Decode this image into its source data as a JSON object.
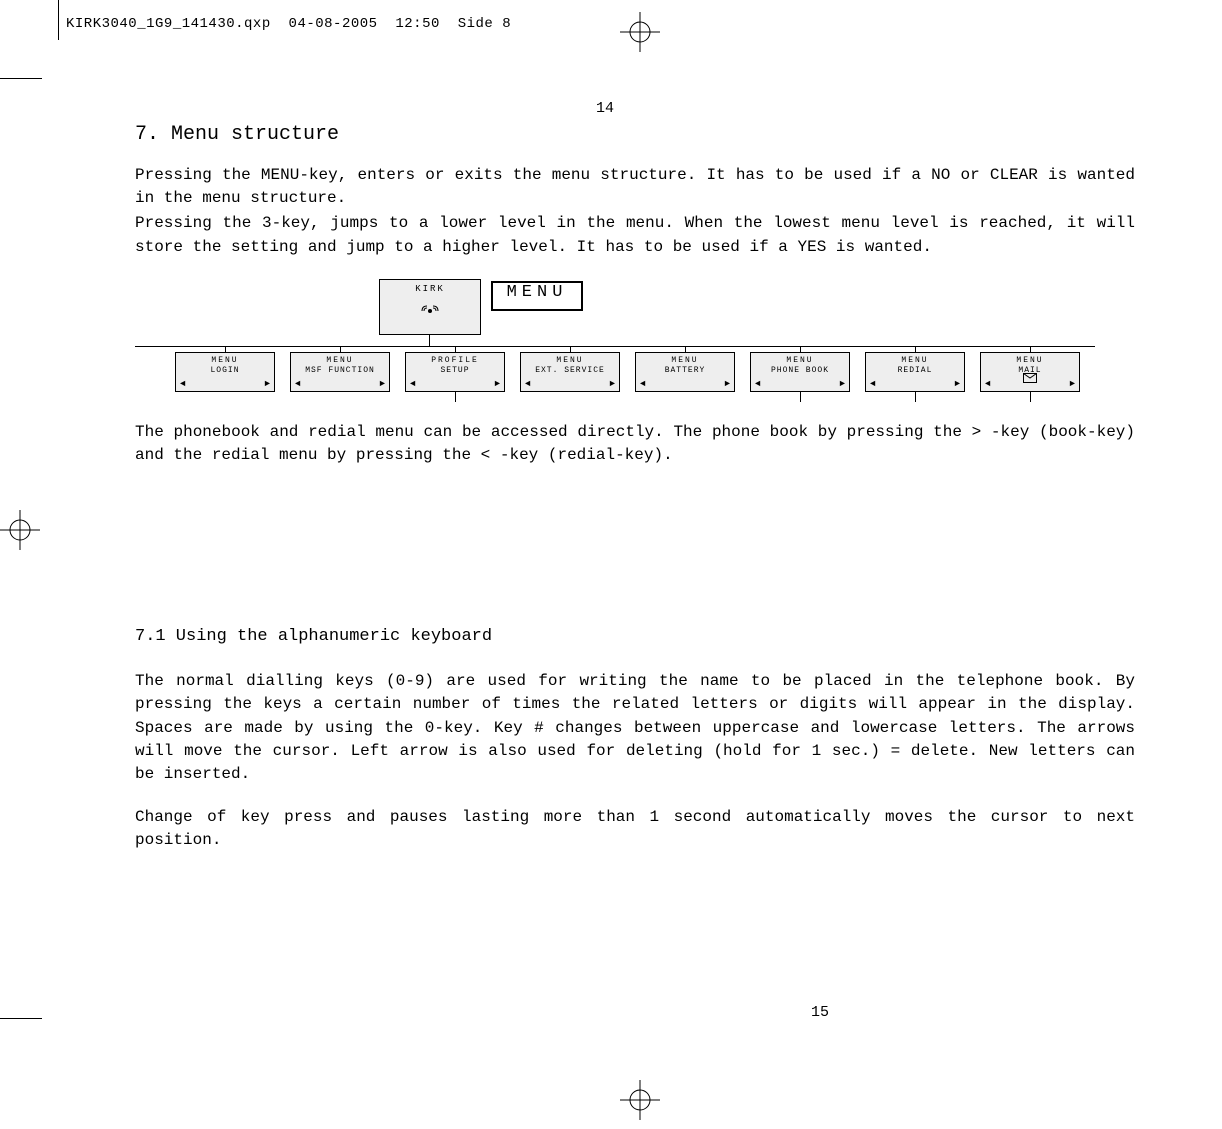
{
  "header": {
    "filename": "KIRK3040_1G9_141430.qxp",
    "date": "04-08-2005",
    "time": "12:50",
    "side": "Side 8"
  },
  "page": {
    "top_number": "14",
    "bottom_number": "15"
  },
  "section7": {
    "title": "7. Menu structure",
    "para1": "Pressing the MENU-key, enters or exits the menu structure. It has to be used if a  NO  or  CLEAR  is wanted in the menu structure.",
    "para2": "Pressing the  3-key, jumps to a lower level in the menu. When the lowest menu level is reached, it will store the setting and jump to a higher level. It has to be used if a  YES  is wanted.",
    "after_diagram": "The phonebook and redial menu can be accessed directly. The phone book by pressing the > -key (book-key) and the redial menu by pressing the < -key (redial-key)."
  },
  "diagram": {
    "kirk_label": "KIRK",
    "menu_label": "MENU",
    "items": [
      {
        "line1": "MENU",
        "line2": "LOGIN"
      },
      {
        "line1": "MENU",
        "line2": "MSF FUNCTION"
      },
      {
        "line1": "PROFILE",
        "line2": "SETUP"
      },
      {
        "line1": "MENU",
        "line2": "EXT. SERVICE"
      },
      {
        "line1": "MENU",
        "line2": "BATTERY"
      },
      {
        "line1": "MENU",
        "line2": "PHONE BOOK"
      },
      {
        "line1": "MENU",
        "line2": "REDIAL"
      },
      {
        "line1": "MENU",
        "line2": "MAIL",
        "mail": true
      }
    ]
  },
  "section71": {
    "title": "7.1 Using the alphanumeric keyboard",
    "para1": "The normal dialling keys (0-9) are used for writing the name to be placed in the telephone book. By pressing the keys a certain number of times the related letters or digits will appear in the display. Spaces are made by using the 0-key. Key # changes between uppercase and lowercase letters. The arrows will move the cursor. Left arrow is also used for deleting (hold for 1 sec.) = delete.  New letters can be inserted.",
    "para2": "Change of key press and pauses lasting more than 1 second automatically moves the cursor to next position."
  }
}
